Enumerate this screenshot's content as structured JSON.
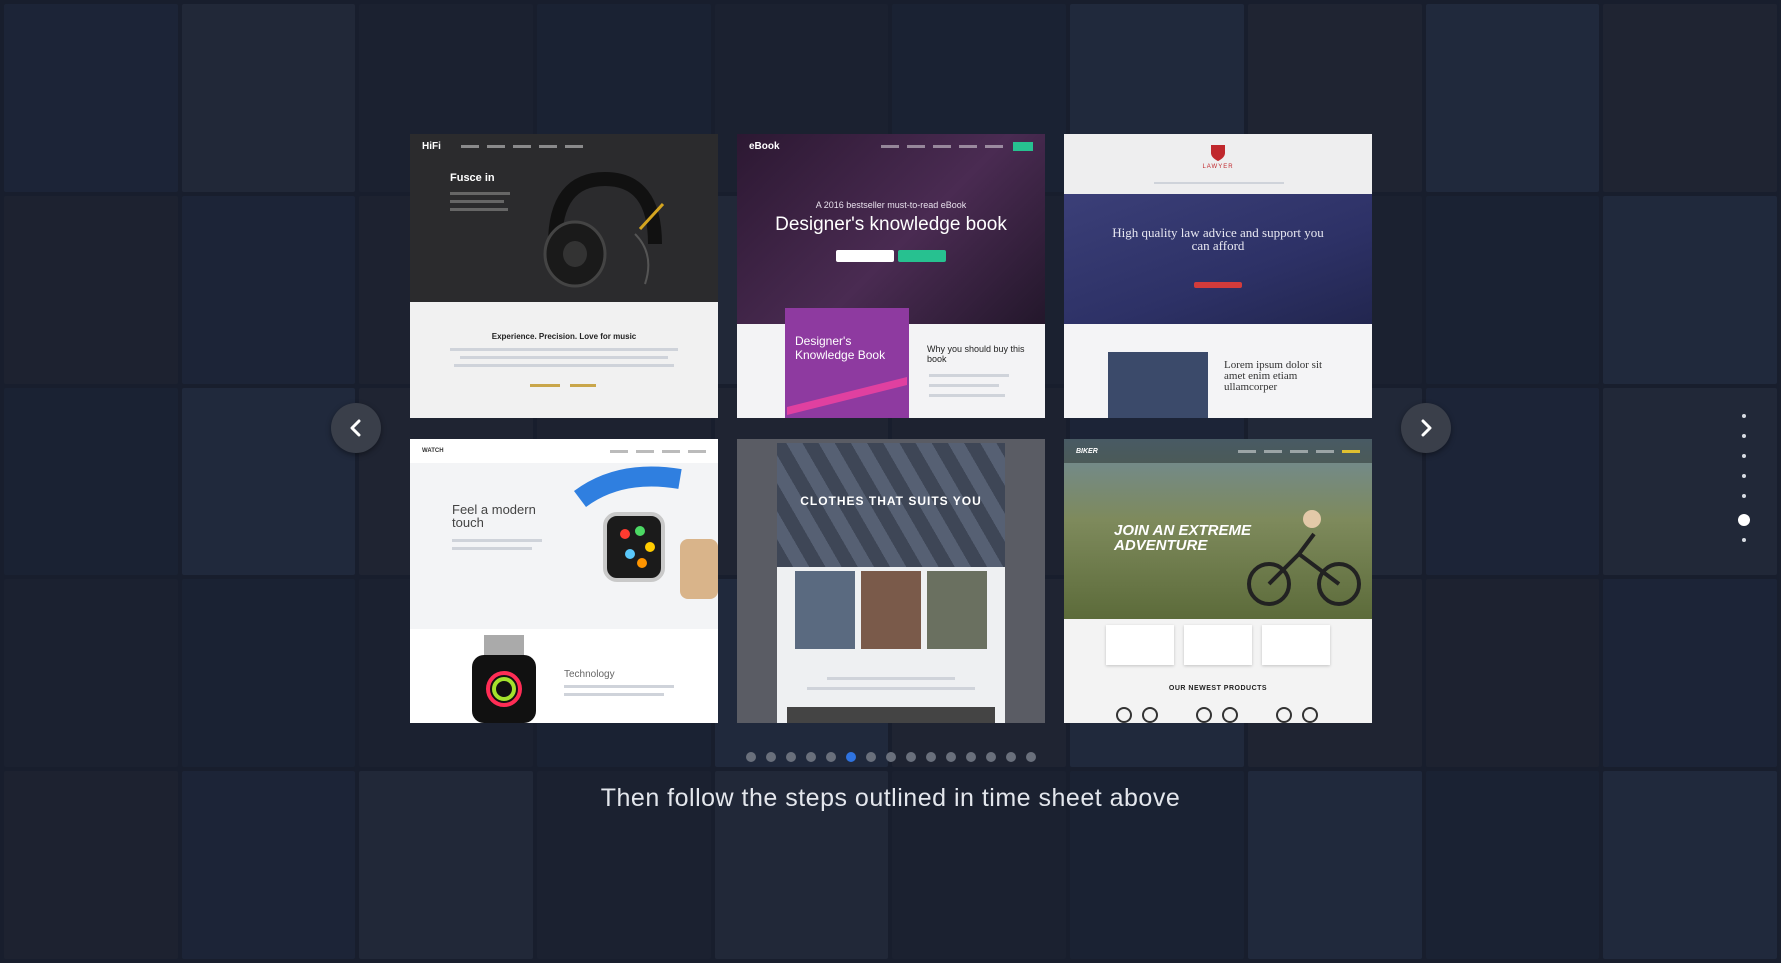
{
  "colors": {
    "background": "#1c2331",
    "accent": "#2f73e0"
  },
  "slides": [
    {
      "id": "hifi",
      "logo": "HiFi",
      "headline": "Fusce in",
      "subheadline": "Experience. Precision. Love for music"
    },
    {
      "id": "ebook",
      "logo": "eBook",
      "kicker": "A 2016 bestseller must-to-read eBook",
      "headline": "Designer's knowledge book",
      "book_title": "Designer's Knowledge Book",
      "side_title": "Why you should buy this book"
    },
    {
      "id": "lawyer",
      "logo": "LAWYER",
      "headline": "High quality law advice and support you can afford",
      "body": "Lorem ipsum dolor sit amet enim etiam ullamcorper"
    },
    {
      "id": "watch",
      "logo": "WATCH",
      "headline": "Feel a modern touch",
      "section": "Technology"
    },
    {
      "id": "fashion",
      "headline": "CLOTHES THAT SUITS YOU"
    },
    {
      "id": "biker",
      "logo": "BIKER",
      "headline": "JOIN AN EXTREME ADVENTURE",
      "section": "OUR NEWEST PRODUCTS"
    }
  ],
  "controls": {
    "prev_icon": "chevron-left-icon",
    "next_icon": "chevron-right-icon"
  },
  "pagination": {
    "count": 15,
    "active_index": 5
  },
  "side_nav": {
    "count": 7,
    "active_index": 5
  },
  "caption": "Then follow the steps outlined in time sheet above"
}
